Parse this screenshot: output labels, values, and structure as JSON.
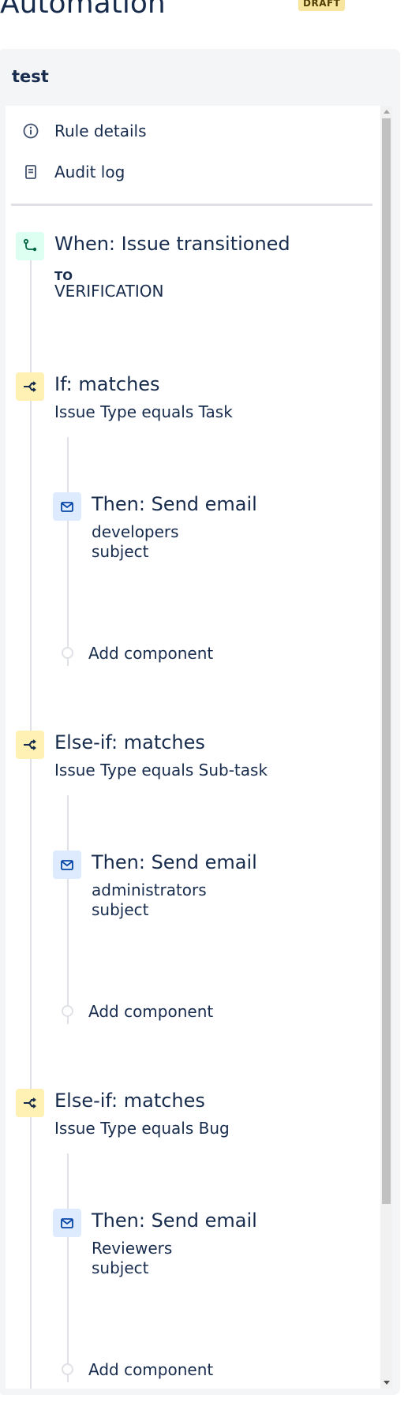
{
  "header": {
    "title": "Automation",
    "status_badge": "DRAFT"
  },
  "rule": {
    "name": "test"
  },
  "nav": {
    "rule_details": "Rule details",
    "audit_log": "Audit log"
  },
  "trigger": {
    "title": "When: Issue transitioned",
    "to_label": "TO",
    "to_value": "VERIFICATION",
    "icon": "transition-icon"
  },
  "branches": [
    {
      "title": "If: matches",
      "condition": "Issue Type equals Task",
      "action": {
        "title": "Then: Send email",
        "recipient": "developers",
        "subject": "subject"
      },
      "add_label": "Add component"
    },
    {
      "title": "Else-if: matches",
      "condition": "Issue Type equals Sub-task",
      "action": {
        "title": "Then: Send email",
        "recipient": "administrators",
        "subject": "subject"
      },
      "add_label": "Add component"
    },
    {
      "title": "Else-if: matches",
      "condition": "Issue Type equals Bug",
      "action": {
        "title": "Then: Send email",
        "recipient": "Reviewers",
        "subject": "subject"
      },
      "add_label": "Add component"
    }
  ],
  "colors": {
    "trigger_bg": "#dcfff1",
    "condition_bg": "#fff0b3",
    "action_bg": "#deebff",
    "text": "#172b4d"
  }
}
